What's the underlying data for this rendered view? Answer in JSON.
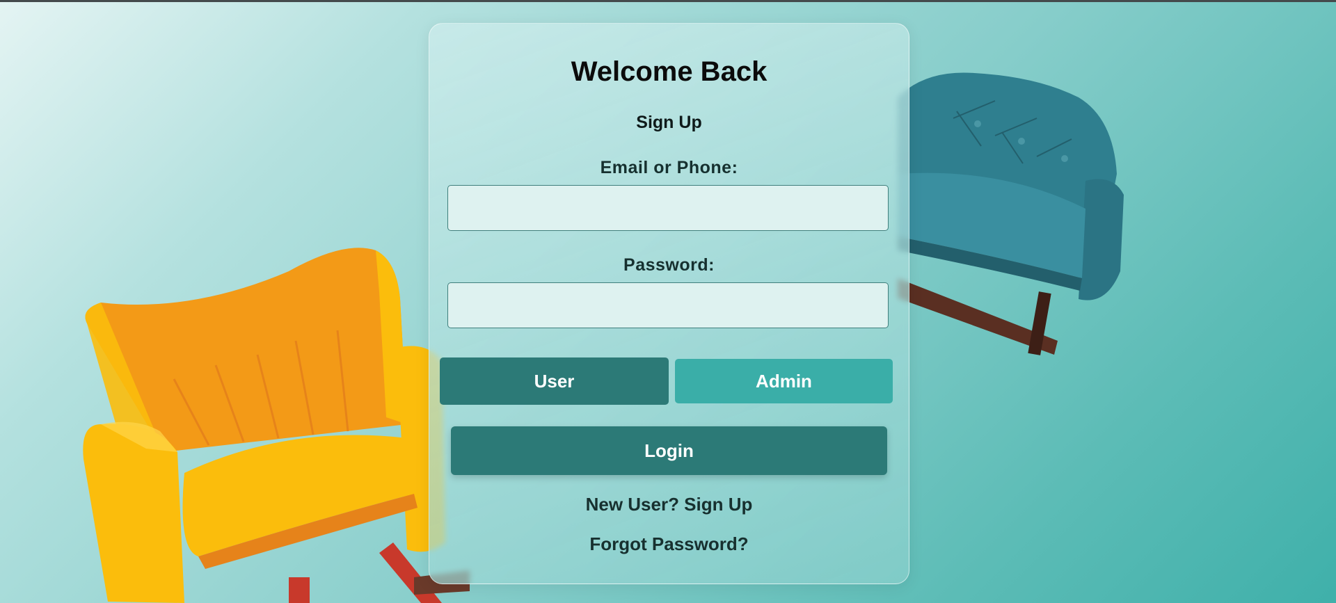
{
  "colors": {
    "primary": "#2c7a77",
    "accent": "#3aaea8",
    "field_bg": "#def2f0",
    "chair_yellow": "#fbbd0c",
    "chair_orange": "#f39a17",
    "chair_teal": "#2f7f8f"
  },
  "login": {
    "title": "Welcome Back",
    "signup_top": "Sign Up",
    "email_label": "Email or Phone:",
    "email_value": "",
    "password_label": "Password:",
    "password_value": "",
    "roles": [
      "User",
      "Admin"
    ],
    "selected_role": "User",
    "login_button": "Login",
    "new_user_link": "New User? Sign Up",
    "forgot_link": "Forgot Password?"
  },
  "decor": {
    "left_image": "yellow-armchair",
    "right_image": "teal-armchair"
  }
}
